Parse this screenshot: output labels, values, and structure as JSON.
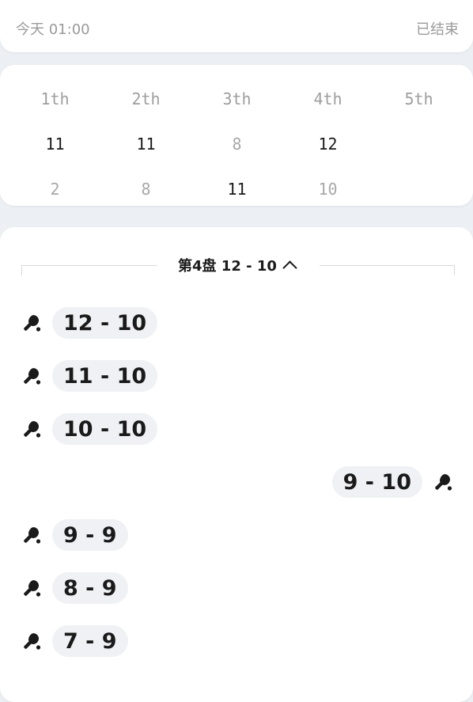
{
  "header": {
    "time": "今天 01:00",
    "status": "已结束"
  },
  "scoreboard": {
    "columns": [
      "1th",
      "2th",
      "3th",
      "4th",
      "5th"
    ],
    "rows": [
      [
        {
          "v": "11",
          "win": true
        },
        {
          "v": "11",
          "win": true
        },
        {
          "v": "8",
          "win": false
        },
        {
          "v": "12",
          "win": true
        },
        {
          "v": "",
          "win": false
        }
      ],
      [
        {
          "v": "2",
          "win": false
        },
        {
          "v": "8",
          "win": false
        },
        {
          "v": "11",
          "win": true
        },
        {
          "v": "10",
          "win": false
        },
        {
          "v": "",
          "win": false
        }
      ]
    ]
  },
  "detail": {
    "set_title": "第4盘 12 - 10",
    "points": [
      {
        "score": "12 - 10",
        "side": "left"
      },
      {
        "score": "11 - 10",
        "side": "left"
      },
      {
        "score": "10 - 10",
        "side": "left"
      },
      {
        "score": "9 - 10",
        "side": "right"
      },
      {
        "score": "9 - 9",
        "side": "left"
      },
      {
        "score": "8 - 9",
        "side": "left"
      },
      {
        "score": "7 - 9",
        "side": "left"
      }
    ]
  },
  "icons": {
    "point": "paddle-icon",
    "toggle": "chevron-up-icon"
  }
}
